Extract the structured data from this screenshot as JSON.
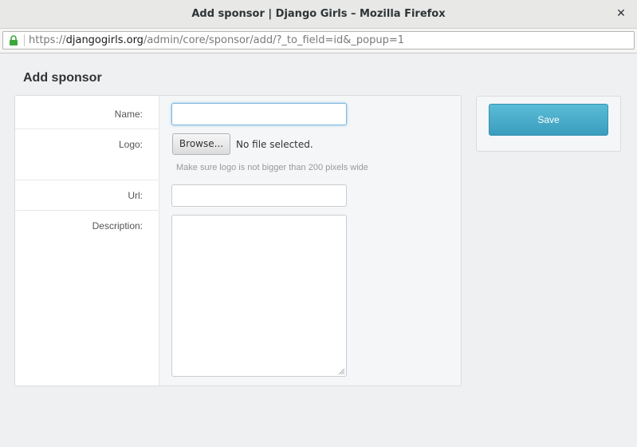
{
  "window": {
    "title": "Add sponsor | Django Girls – Mozilla Firefox",
    "close_glyph": "✕"
  },
  "address_bar": {
    "scheme": "https://",
    "host": "djangogirls.org",
    "path": "/admin/core/sponsor/add/?_to_field=id&_popup=1",
    "lock_color": "#3ea73a"
  },
  "page": {
    "title": "Add sponsor"
  },
  "form": {
    "name": {
      "label": "Name:",
      "value": ""
    },
    "logo": {
      "label": "Logo:",
      "browse_label": "Browse...",
      "file_status": "No file selected.",
      "help_text": "Make sure logo is not bigger than 200 pixels wide"
    },
    "url": {
      "label": "Url:",
      "value": ""
    },
    "description": {
      "label": "Description:",
      "value": ""
    }
  },
  "actions": {
    "save_label": "Save",
    "save_color": "#46a9c9"
  }
}
